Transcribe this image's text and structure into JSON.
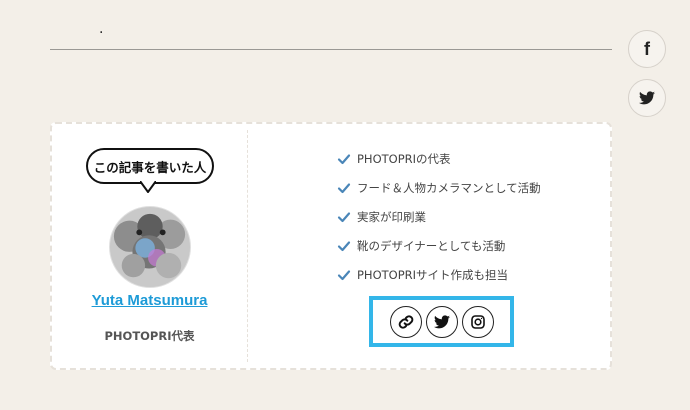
{
  "header": {
    "dot": "."
  },
  "share": {
    "facebook_glyph": "f"
  },
  "author": {
    "bubble_label": "この記事を書いた人",
    "name": "Yuta Matsumura",
    "role": "PHOTOPRI代表",
    "bio": [
      "PHOTOPRIの代表",
      "フード＆人物カメラマンとして活動",
      "実家が印刷業",
      "靴のデザイナーとしても活動",
      "PHOTOPRIサイト作成も担当"
    ],
    "links": [
      "link-icon",
      "twitter-icon",
      "instagram-icon"
    ]
  },
  "colors": {
    "background": "#f3efe8",
    "author_name": "#1e9bd7",
    "check": "#4a86b8",
    "highlight_box": "#33b6e9"
  }
}
